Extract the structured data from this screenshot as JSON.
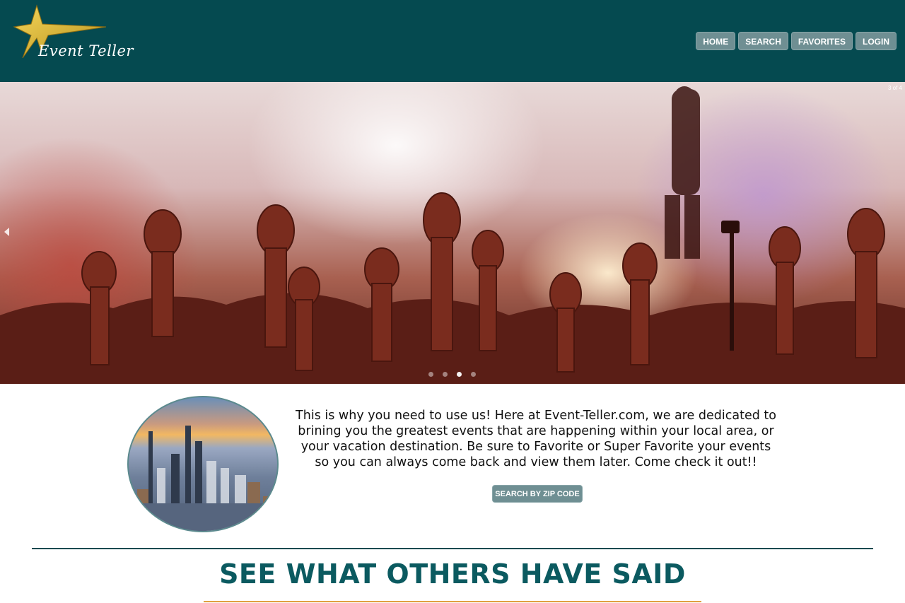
{
  "brand": {
    "logo_text": "Event Teller",
    "logo_icon": "star-icon",
    "header_color": "#054a50",
    "star_color": "#d8b22a"
  },
  "nav": {
    "items": [
      {
        "label": "HOME"
      },
      {
        "label": "SEARCH"
      },
      {
        "label": "FAVORITES"
      },
      {
        "label": "LOGIN"
      }
    ]
  },
  "hero": {
    "counter": "3 of 4",
    "prev_icon": "chevron-left-icon",
    "slide_count": 4,
    "active_slide": 3
  },
  "intro": {
    "text": "This is why you need to use us! Here at Event-Teller.com, we are dedicated to brining you the greatest events that are happening within your local area, or your vacation destination. Be sure to Favorite or Super Favorite your events so you can always come back and view them later. Come check it out!!",
    "button_label": "SEARCH BY ZIP CODE"
  },
  "testimonials": {
    "title": "SEE WHAT OTHERS HAVE SAID",
    "accent_color": "#e0a040"
  }
}
